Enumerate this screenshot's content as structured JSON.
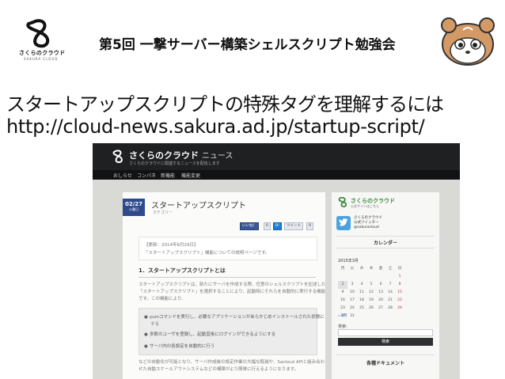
{
  "slide": {
    "logo_text": "さくらのクラウド",
    "logo_sub": "SAKURA CLOUD",
    "title": "第5回 一撃サーバー構築シェルスクリプト勉強会",
    "heading": "スタートアップスクリプトの特殊タグを理解するには",
    "url": "http://cloud-news.sakura.ad.jp/startup-script/"
  },
  "site": {
    "name": "さくらのクラウド",
    "name_suffix": "ニュース",
    "tagline": "さくらのクラウドに関連するニュースを配信します",
    "nav": [
      "おしらせ",
      "コンパネ",
      "新機能",
      "機能変更"
    ]
  },
  "post": {
    "date_day": "02/27",
    "date_year": "火曜日",
    "title": "スタートアップスクリプト",
    "category": "カテゴリー",
    "share": [
      "いいね！",
      "0",
      "B!",
      "ツイート",
      "0"
    ],
    "box_line1": "【更新：2014年8月29日】",
    "box_line2": "「スタートアップスクリプト」機能についての説明ページです。",
    "h2": "1．スタートアップスクリプトとは",
    "p1": "スタートアップスクリプトは、新たにサーバを作成する際、任意のシェルスクリプトを記述した",
    "p2": "「スタートアップスクリプト」を選択することにより、起動時にそれらを自動的に実行する機能",
    "p3": "です。この機能により、",
    "features": [
      "yumコマンドを実行し、必要なアプリケーションがあらかじめインストールされた状態に",
      "する",
      "多数のユーザを登録し、起動直後にログインができるようにする",
      "サーバ内の各設定を自動的に行う"
    ],
    "p4": "などの自動化が可能となり、サーバ作成後の設定作業の大幅な軽減や、Sacloud APIと組み合わ",
    "p5": "せた自動スケールアウトシステムなどの構築がより簡単に行えるようになります。"
  },
  "sidebar": {
    "brand": "さくらのクラウド",
    "brand_sub": "公式サイトはこちら",
    "twitter_text": "さくらのクラウド\n公式ツイッター\n@sakuracloud",
    "calendar_heading": "カレンダー",
    "calendar_month": "2015年3月",
    "weekdays": [
      "月",
      "火",
      "水",
      "木",
      "金",
      "土",
      "日"
    ],
    "weeks": [
      [
        "",
        "",
        "",
        "",
        "",
        "",
        "1"
      ],
      [
        "2",
        "3",
        "4",
        "5",
        "6",
        "7",
        "8"
      ],
      [
        "9",
        "10",
        "11",
        "12",
        "13",
        "14",
        "15"
      ],
      [
        "16",
        "17",
        "18",
        "19",
        "20",
        "21",
        "22"
      ],
      [
        "23",
        "24",
        "25",
        "26",
        "27",
        "28",
        "29"
      ],
      [
        "30",
        "31",
        "",
        "",
        "",
        "",
        ""
      ]
    ],
    "prev_month": "« 2月",
    "search_label": "検索:",
    "search_button": "検索",
    "docs_heading": "各種ドキュメント"
  },
  "colors": {
    "site_header": "#1f2022",
    "date_badge": "#2d4a8c",
    "brand_green": "#3e8b3e",
    "twitter_blue": "#4aa3df"
  }
}
